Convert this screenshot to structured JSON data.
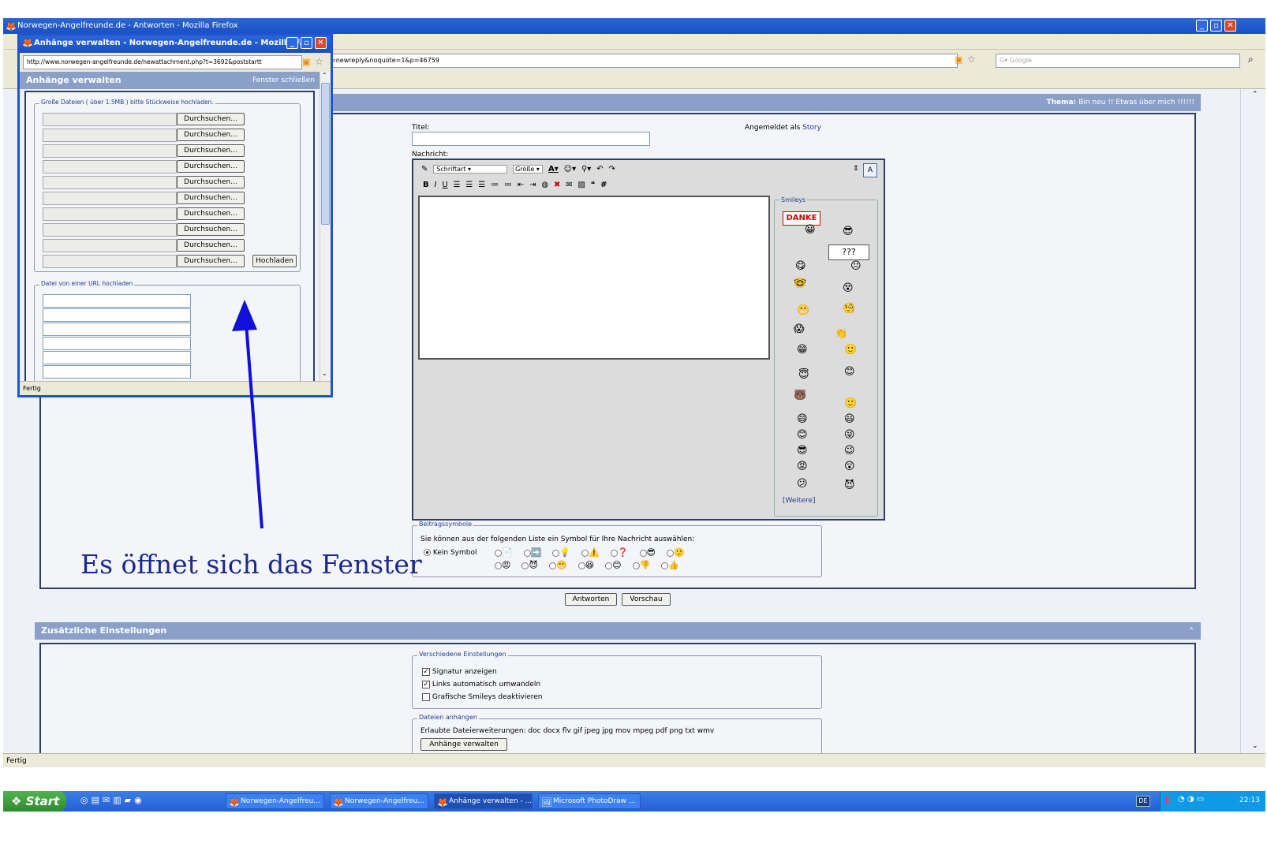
{
  "main_window": {
    "title": "Norwegen-Angelfreunde.de - Antworten - Mozilla Firefox",
    "url_suffix": "=newreply&noquote=1&p=46759",
    "search_placeholder": "Google",
    "status": "Fertig",
    "thread_label": "Thema:",
    "thread_title": "Bin neu !! Etwas über mich !!!!!!"
  },
  "form": {
    "title_label": "Titel:",
    "logged_in_label": "Angemeldet als",
    "logged_in_user": "Story",
    "message_label": "Nachricht:",
    "font_select": "Schriftart",
    "size_select": "Größe",
    "smileys_legend": "Smileys",
    "more_smileys": "[Weitere]",
    "post_icons_legend": "Beitragssymbole",
    "post_icons_text": "Sie können aus der folgenden Liste ein Symbol für Ihre Nachricht auswählen:",
    "no_symbol": "Kein Symbol",
    "reply_button": "Antworten",
    "preview_button": "Vorschau"
  },
  "extra": {
    "header": "Zusätzliche Einstellungen",
    "misc_legend": "Verschiedene Einstellungen",
    "options": [
      {
        "label": "Signatur anzeigen",
        "checked": true
      },
      {
        "label": "Links automatisch umwandeln",
        "checked": true
      },
      {
        "label": "Grafische Smileys deaktivieren",
        "checked": false
      }
    ],
    "attach_legend": "Dateien anhängen",
    "allowed_ext": "Erlaubte Dateierweiterungen: doc docx flv gif jpeg jpg mov mpeg pdf png txt wmv",
    "manage_button": "Anhänge verwalten"
  },
  "popup": {
    "title": "Anhänge verwalten - Norwegen-Angelfreunde.de - Mozilla F...",
    "url": "http://www.norwegen-angelfreunde.de/newattachment.php?t=3692&poststartt",
    "header": "Anhänge verwalten",
    "close_link": "Fenster schließen",
    "large_files_legend": "Große Dateien ( über 1.5MB ) bitte Stückweise hochladen.",
    "browse_label": "Durchsuchen...",
    "upload_button": "Hochladen",
    "url_legend": "Datei von einer URL hochladen",
    "status": "Fertig"
  },
  "annotation": "Es öffnet sich das Fenster",
  "taskbar": {
    "start": "Start",
    "items": [
      "Norwegen-Angelfreu...",
      "Norwegen-Angelfreu...",
      "Anhänge verwalten - ...",
      "Microsoft PhotoDraw ..."
    ],
    "lang": "DE",
    "clock": "22:13"
  }
}
